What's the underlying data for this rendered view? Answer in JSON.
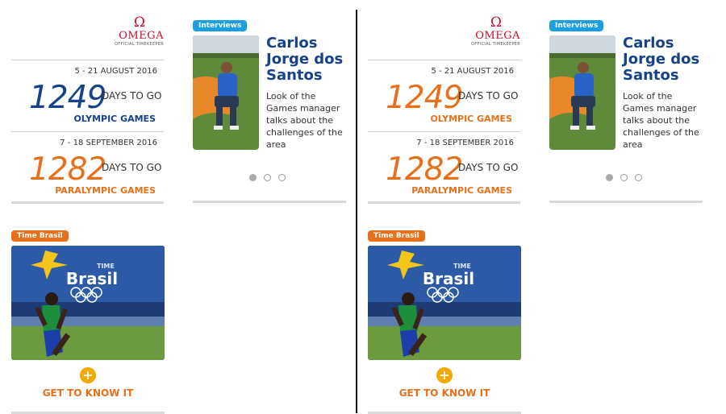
{
  "colors": {
    "olympic_left": "#15428b",
    "olympic_right": "#e8701a",
    "paralympic": "#e8701a",
    "omega_red": "#c8102e",
    "interview_badge": "#1aa0e0",
    "brasil_badge": "#e8701a",
    "gold_button": "#f5a800"
  },
  "panels": [
    {
      "omega": {
        "symbol": "Ω",
        "brand": "OMEGA",
        "tagline": "OFFICIAL TIMEKEEPER"
      },
      "olympic": {
        "dates": "5 - 21 AUGUST 2016",
        "days": "1249",
        "days_label": "DAYS TO GO",
        "name": "OLYMPIC GAMES"
      },
      "paralympic": {
        "dates": "7 - 18 SEPTEMBER 2016",
        "days": "1282",
        "days_label": "DAYS TO GO",
        "name": "PARALYMPIC GAMES"
      },
      "interview": {
        "badge": "Interviews",
        "name": "Carlos Jorge dos Santos",
        "description": "Look of the Games manager talks about the challenges of the area",
        "slides": 3,
        "active_slide": 1
      },
      "time_brasil": {
        "badge": "Time Brasil",
        "image_text": "TIME Brasil",
        "cta_icon": "+",
        "cta": "GET TO KNOW IT"
      }
    },
    {
      "omega": {
        "symbol": "Ω",
        "brand": "OMEGA",
        "tagline": "OFFICIAL TIMEKEEPER"
      },
      "olympic": {
        "dates": "5 - 21 AUGUST 2016",
        "days": "1249",
        "days_label": "DAYS TO GO",
        "name": "OLYMPIC GAMES"
      },
      "paralympic": {
        "dates": "7 - 18 SEPTEMBER 2016",
        "days": "1282",
        "days_label": "DAYS TO GO",
        "name": "PARALYMPIC GAMES"
      },
      "interview": {
        "badge": "Interviews",
        "name": "Carlos Jorge dos Santos",
        "description": "Look of the Games manager talks about the challenges of the area",
        "slides": 3,
        "active_slide": 1
      },
      "time_brasil": {
        "badge": "Time Brasil",
        "image_text": "TIME Brasil",
        "cta_icon": "+",
        "cta": "GET TO KNOW IT"
      }
    }
  ]
}
